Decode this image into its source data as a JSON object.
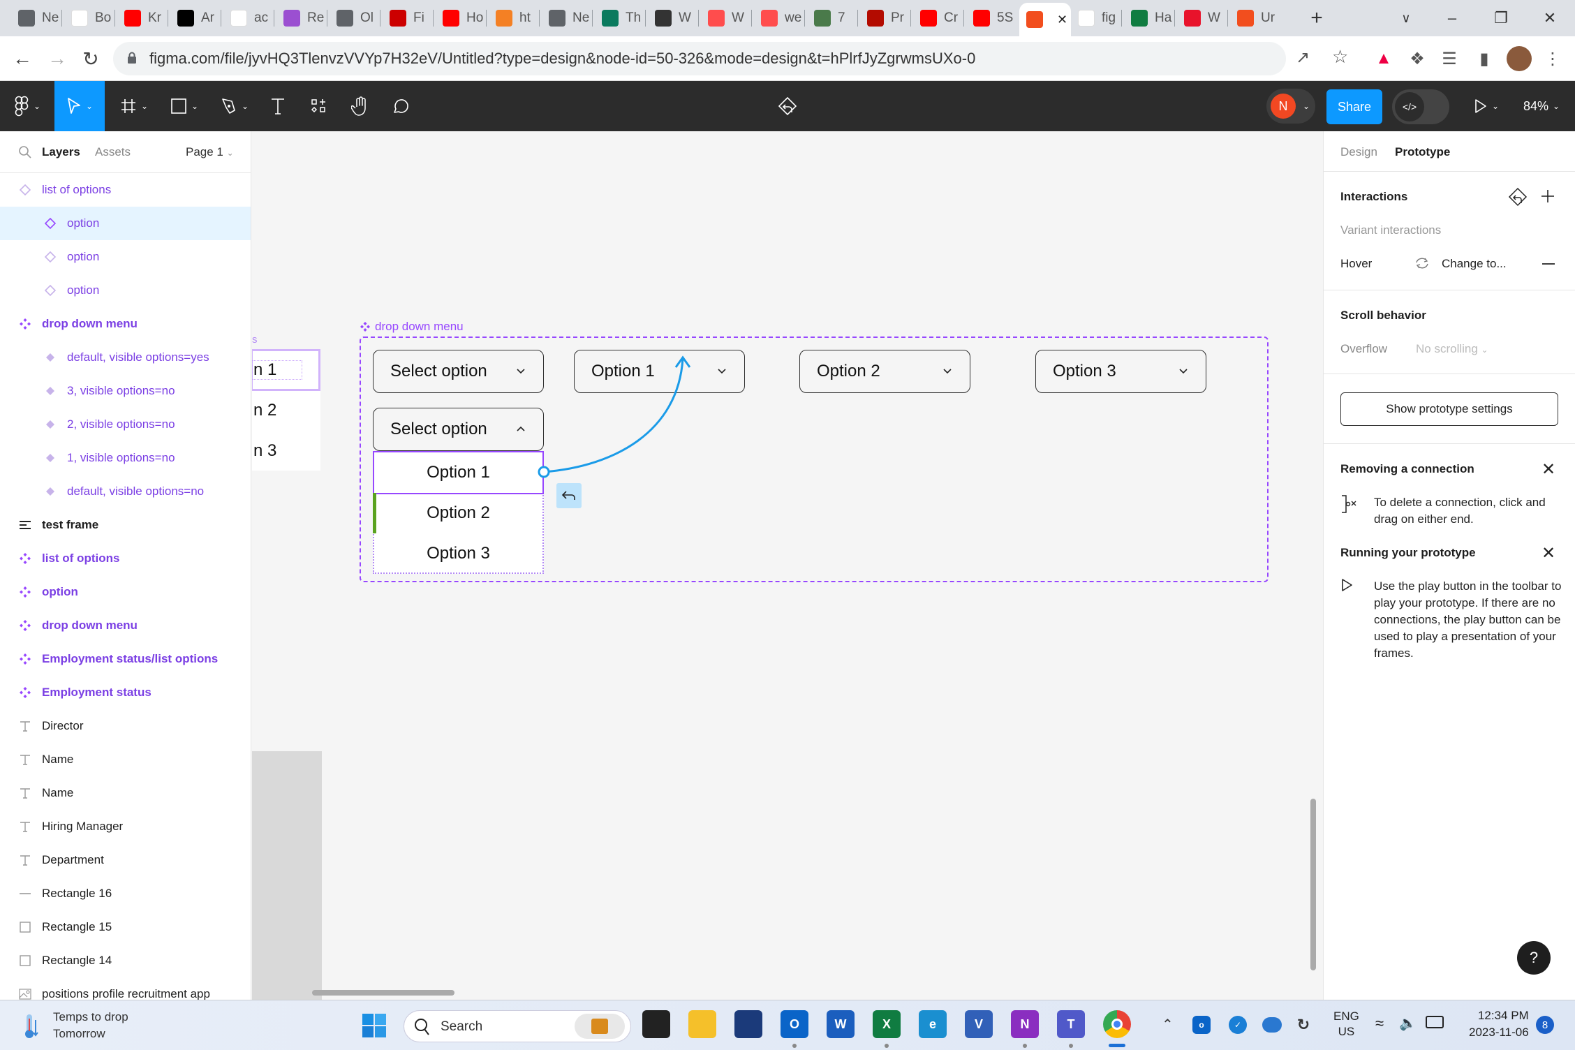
{
  "browser": {
    "tabs": [
      {
        "label": "Ne",
        "icon": "chrome-icon",
        "color": "#5f6368"
      },
      {
        "label": "Bo",
        "icon": "wikipedia-icon",
        "color": "#ffffff"
      },
      {
        "label": "Kr",
        "icon": "youtube-icon",
        "color": "#ff0000"
      },
      {
        "label": "Ar",
        "icon": "medium-icon",
        "color": "#000000"
      },
      {
        "label": "ac",
        "icon": "google-icon",
        "color": "#ffffff"
      },
      {
        "label": "Re",
        "icon": "powerapps-icon",
        "color": "#9b4fd1"
      },
      {
        "label": "Ol",
        "icon": "globe-icon",
        "color": "#5f6368"
      },
      {
        "label": "Fi",
        "icon": "bu-icon",
        "color": "#cc0000"
      },
      {
        "label": "Ho",
        "icon": "youtube-icon",
        "color": "#ff0000"
      },
      {
        "label": "ht",
        "icon": "stackoverflow-icon",
        "color": "#f48024"
      },
      {
        "label": "Ne",
        "icon": "chrome-icon",
        "color": "#5f6368"
      },
      {
        "label": "Th",
        "icon": "w-brand-icon",
        "color": "#0a7a5e"
      },
      {
        "label": "W",
        "icon": "bird-icon",
        "color": "#333333"
      },
      {
        "label": "W",
        "icon": "m-brand-icon",
        "color": "#ff4d4d"
      },
      {
        "label": "we",
        "icon": "m-brand-icon",
        "color": "#ff4d4d"
      },
      {
        "label": "7",
        "icon": "plant-icon",
        "color": "#4a7a4a"
      },
      {
        "label": "Pr",
        "icon": "acrobat-icon",
        "color": "#b30b00"
      },
      {
        "label": "Cr",
        "icon": "youtube-icon",
        "color": "#ff0000"
      },
      {
        "label": "5S",
        "icon": "youtube-icon",
        "color": "#ff0000"
      },
      {
        "label": "",
        "icon": "figma-icon",
        "color": "#f24e1e",
        "active": true
      },
      {
        "label": "fig",
        "icon": "google-icon",
        "color": "#ffffff"
      },
      {
        "label": "Ha",
        "icon": "excel-icon",
        "color": "#107c41"
      },
      {
        "label": "W",
        "icon": "star-icon",
        "color": "#e8132b"
      },
      {
        "label": "Ur",
        "icon": "figma-icon",
        "color": "#f24e1e"
      }
    ],
    "new_tab": "+",
    "url": "figma.com/file/jyvHQ3TlenvzVVYp7H32eV/Untitled?type=design&node-id=50-326&mode=design&t=hPlrfJyZgrwmsUXo-0"
  },
  "figma_toolbar": {
    "share_label": "Share",
    "avatar_initial": "N",
    "zoom_level": "84%",
    "code_label": "</>"
  },
  "left_panel": {
    "tabs": {
      "layers": "Layers",
      "assets": "Assets",
      "page": "Page 1"
    },
    "layers": [
      {
        "label": "list of options",
        "icon": "component-outline-icon",
        "indent": 0,
        "style": "purple"
      },
      {
        "label": "option",
        "icon": "component-outline-icon",
        "indent": 1,
        "style": "purple",
        "selected": true
      },
      {
        "label": "option",
        "icon": "component-outline-icon",
        "indent": 1,
        "style": "purple"
      },
      {
        "label": "option",
        "icon": "component-outline-icon",
        "indent": 1,
        "style": "purple"
      },
      {
        "label": "drop down menu",
        "icon": "component-set-icon",
        "indent": 0,
        "style": "purple-bold"
      },
      {
        "label": "default, visible options=yes",
        "icon": "variant-icon",
        "indent": 1,
        "style": "purple"
      },
      {
        "label": "3, visible options=no",
        "icon": "variant-icon",
        "indent": 1,
        "style": "purple"
      },
      {
        "label": "2, visible options=no",
        "icon": "variant-icon",
        "indent": 1,
        "style": "purple"
      },
      {
        "label": "1, visible options=no",
        "icon": "variant-icon",
        "indent": 1,
        "style": "purple"
      },
      {
        "label": "default, visible options=no",
        "icon": "variant-icon",
        "indent": 1,
        "style": "purple"
      },
      {
        "label": "test frame",
        "icon": "auto-layout-frame-icon",
        "indent": 0,
        "style": "dark-bold"
      },
      {
        "label": "list of options",
        "icon": "component-set-icon",
        "indent": 0,
        "style": "purple-bold"
      },
      {
        "label": "option",
        "icon": "component-set-icon",
        "indent": 0,
        "style": "purple-bold"
      },
      {
        "label": "drop down menu",
        "icon": "component-set-icon",
        "indent": 0,
        "style": "purple-bold"
      },
      {
        "label": "Employment status/list options",
        "icon": "component-set-icon",
        "indent": 0,
        "style": "purple-bold"
      },
      {
        "label": "Employment status",
        "icon": "component-set-icon",
        "indent": 0,
        "style": "purple-bold"
      },
      {
        "label": "Director",
        "icon": "text-icon",
        "indent": 0,
        "style": "dark"
      },
      {
        "label": "Name",
        "icon": "text-icon",
        "indent": 0,
        "style": "dark"
      },
      {
        "label": "Name",
        "icon": "text-icon",
        "indent": 0,
        "style": "dark"
      },
      {
        "label": "Hiring Manager",
        "icon": "text-icon",
        "indent": 0,
        "style": "dark"
      },
      {
        "label": "Department",
        "icon": "text-icon",
        "indent": 0,
        "style": "dark"
      },
      {
        "label": "Rectangle 16",
        "icon": "line-icon",
        "indent": 0,
        "style": "dark"
      },
      {
        "label": "Rectangle 15",
        "icon": "rectangle-icon",
        "indent": 0,
        "style": "dark"
      },
      {
        "label": "Rectangle 14",
        "icon": "rectangle-icon",
        "indent": 0,
        "style": "dark"
      },
      {
        "label": "positions profile recruitment app",
        "icon": "image-icon",
        "indent": 0,
        "style": "dark"
      }
    ]
  },
  "canvas": {
    "partial_list": {
      "label_fragment": "s",
      "items": [
        "n 1",
        "n 2",
        "n 3"
      ]
    },
    "component_set_label": "drop down menu",
    "dropdowns": [
      {
        "label": "Select option",
        "state": "closed"
      },
      {
        "label": "Option 1",
        "state": "closed"
      },
      {
        "label": "Option 2",
        "state": "closed"
      },
      {
        "label": "Option 3",
        "state": "closed"
      }
    ],
    "open_dropdown": {
      "label": "Select option",
      "state": "open",
      "options": [
        "Option 1",
        "Option 2",
        "Option 3"
      ]
    },
    "accent_purple": "#9747ff",
    "connection_color": "#1a9be8"
  },
  "right_panel": {
    "tabs": {
      "design": "Design",
      "prototype": "Prototype"
    },
    "interactions": {
      "title": "Interactions",
      "variant_label": "Variant interactions",
      "trigger": "Hover",
      "action": "Change to..."
    },
    "scroll": {
      "title": "Scroll behavior",
      "overflow_label": "Overflow",
      "overflow_value": "No scrolling"
    },
    "settings_button": "Show prototype settings",
    "tips": [
      {
        "title": "Removing a connection",
        "body": "To delete a connection, click and drag on either end.",
        "icon": "disconnect-icon"
      },
      {
        "title": "Running your prototype",
        "body": "Use the play button in the toolbar to play your prototype. If there are no connections, the play button can be used to play a presentation of your frames.",
        "icon": "play-icon"
      }
    ],
    "help": "?"
  },
  "taskbar": {
    "weather_title": "Temps to drop",
    "weather_sub": "Tomorrow",
    "search_placeholder": "Search",
    "lang_top": "ENG",
    "lang_bottom": "US",
    "time": "12:34 PM",
    "date": "2023-11-06",
    "notification_count": "8"
  }
}
